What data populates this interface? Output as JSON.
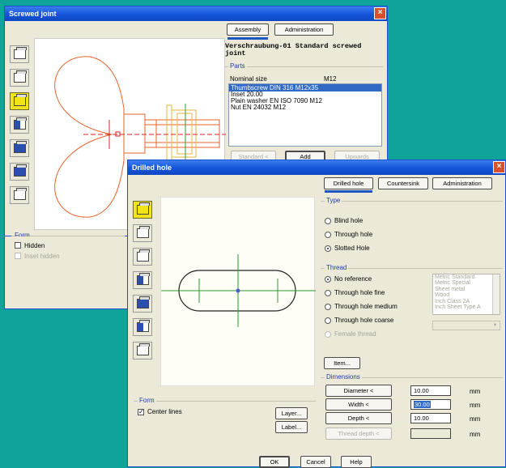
{
  "w1": {
    "title": "Screwed joint",
    "close": "×",
    "tabs": [
      "Assembly",
      "Administration"
    ],
    "heading_line1": "Verschraubung-01 Standard screwed",
    "heading_line2": "joint",
    "parts_label": "Parts",
    "nominal_size_label": "Nominal size",
    "nominal_size_value": "M12",
    "parts": [
      "Thumbscrew DIN 316 M12x35",
      "Inset 20.00",
      "Plain washer EN ISO 7090 M12",
      "Nut EN 24032 M12"
    ],
    "buttons": [
      "Standard <",
      "Add",
      "Upwards"
    ],
    "form_label": "Form",
    "hidden_label": "Hidden",
    "inset_hidden_label": "Inset hidden"
  },
  "w2": {
    "title": "Drilled hole",
    "close": "×",
    "tabs": [
      "Drilled hole",
      "Countersink",
      "Administration"
    ],
    "type_label": "Type",
    "type_options": [
      "Blind hole",
      "Through hole",
      "Slotted Hole"
    ],
    "thread_label": "Thread",
    "thread_options": [
      "No reference",
      "Through hole fine",
      "Through hole medium",
      "Through hole coarse",
      "Female thread"
    ],
    "materials": [
      "Metric Standard",
      "Metric Special",
      "Sheet metal",
      "Wood",
      "Inch Class 2A",
      "Inch Sheet Type A"
    ],
    "item_button": "Item...",
    "dimensions_label": "Dimensions",
    "dims": [
      {
        "label": "Diameter <",
        "value": "10.00",
        "unit": "mm"
      },
      {
        "label": "Width <",
        "value": "30.00",
        "unit": "mm"
      },
      {
        "label": "Depth <",
        "value": "10.00",
        "unit": "mm"
      },
      {
        "label": "Thread depth <",
        "value": "",
        "unit": "mm"
      }
    ],
    "form_label": "Form",
    "center_lines_label": "Center lines",
    "check_mark": "✓",
    "layer_button": "Layer...",
    "label_button": "Label...",
    "ok": "OK",
    "cancel": "Cancel",
    "help": "Help"
  }
}
